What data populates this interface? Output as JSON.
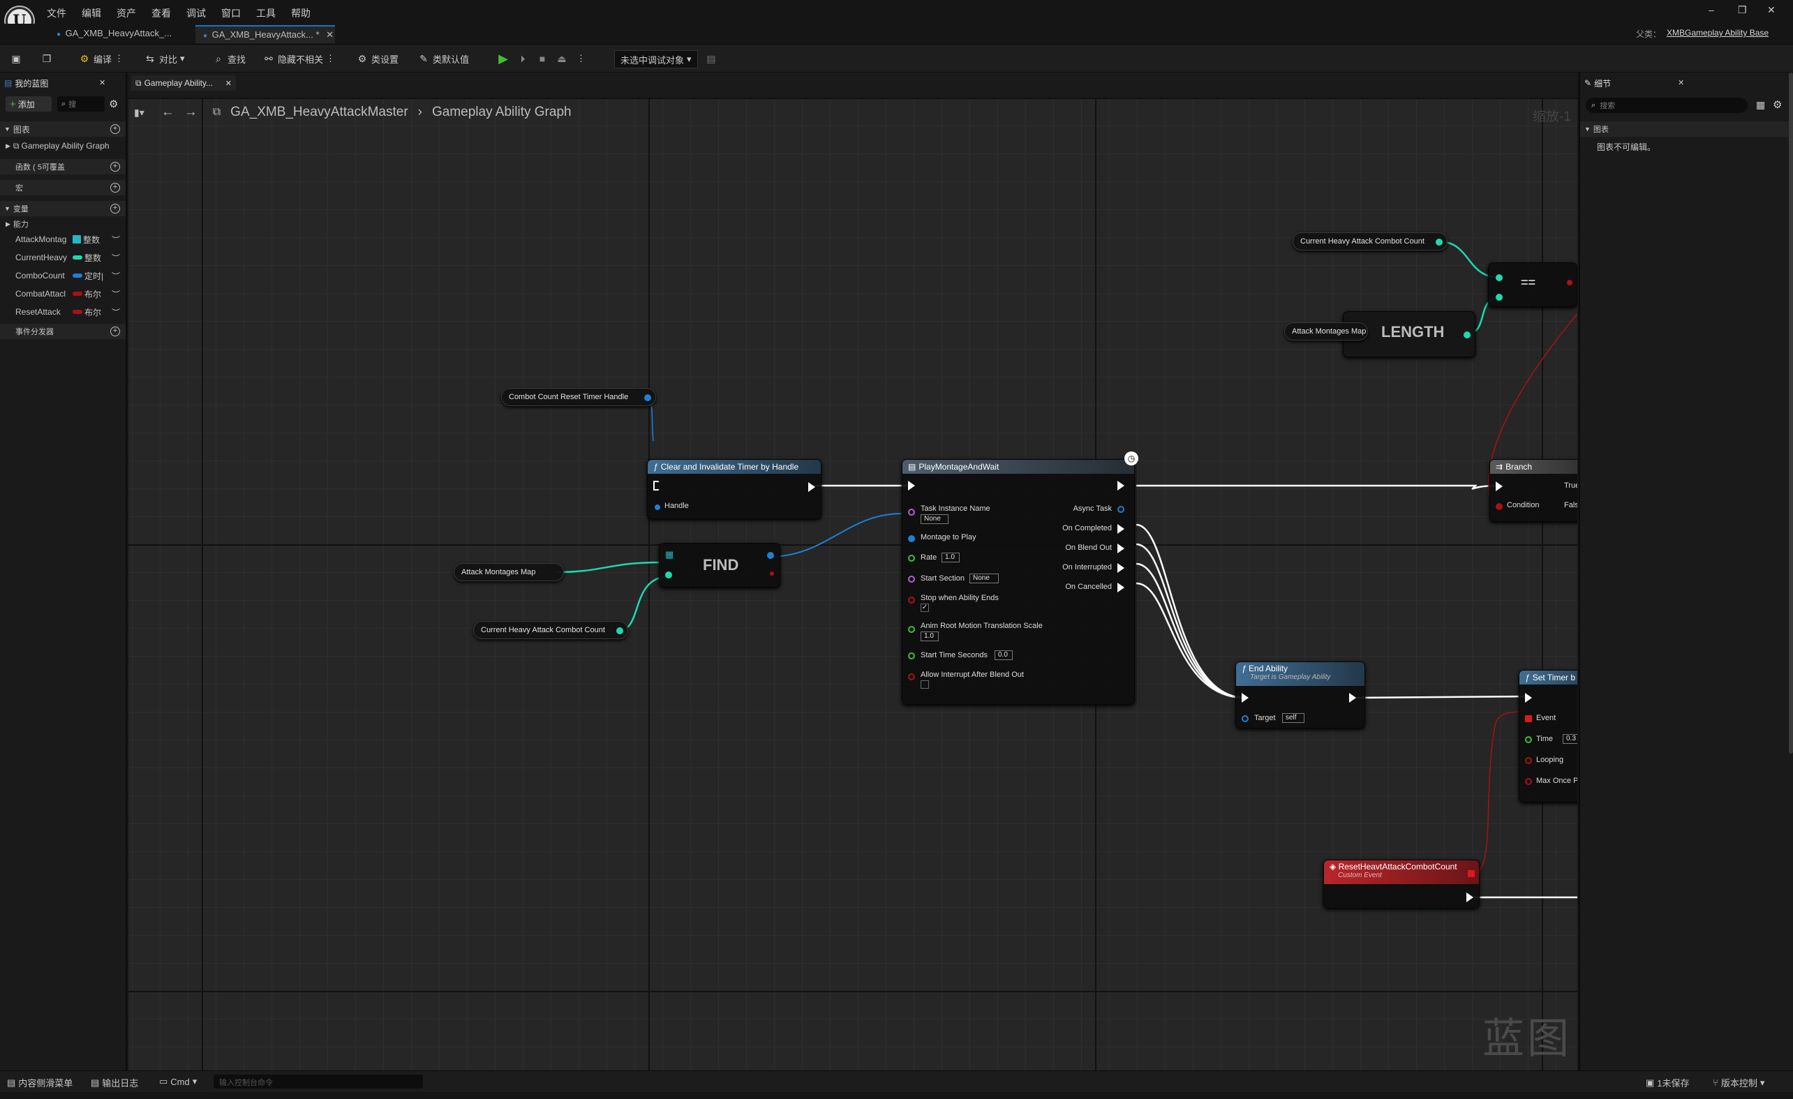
{
  "menu": [
    "文件",
    "编辑",
    "资产",
    "查看",
    "调试",
    "窗口",
    "工具",
    "帮助"
  ],
  "tabs": [
    {
      "label": "GA_XMB_HeavyAttack_..."
    },
    {
      "label": "GA_XMB_HeavyAttack... *"
    }
  ],
  "parent": {
    "label": "父类：",
    "value": "XMBGameplay Ability Base"
  },
  "window_controls": {
    "minimize": "–",
    "restore": "❐",
    "close": "✕"
  },
  "toolbar": {
    "compile": "编译",
    "diff": "对比",
    "find": "查找",
    "hide_unrelated": "隐藏不相关",
    "class_settings": "类设置",
    "class_defaults": "类默认值",
    "debug_target": "未选中调试对象"
  },
  "left_panel": {
    "title": "我的蓝图",
    "add": "添加",
    "search_placeholder": "搜",
    "graphs_header": "图表",
    "graph_item": "Gameplay Ability Graph",
    "functions_header": "函数 ( 5可覆盖",
    "macros_header": "宏",
    "variables_header": "变量",
    "category": "能力",
    "variables": [
      {
        "name": "AttackMontag",
        "type": "整数",
        "color": "#22b8c8"
      },
      {
        "name": "CurrentHeavy",
        "type": "整数",
        "color": "#1ed9b0"
      },
      {
        "name": "ComboCount",
        "type": "定时|",
        "color": "#1e7fd6"
      },
      {
        "name": "CombatAttacl",
        "type": "布尔",
        "color": "#aa1212"
      },
      {
        "name": "ResetAttack",
        "type": "布尔",
        "color": "#aa1212"
      }
    ],
    "dispatchers_header": "事件分发器"
  },
  "graph": {
    "tab": "Gameplay Ability...",
    "breadcrumb_root": "GA_XMB_HeavyAttackMaster",
    "breadcrumb_leaf": "Gameplay Ability Graph",
    "zoom": "缩放-1",
    "watermark": "蓝图",
    "nodes": {
      "combo_reset_handle": "Combot Count Reset Timer Handle",
      "current_combo_top": "Current Heavy Attack Combot Count",
      "attack_montages_top": "Attack Montages Map",
      "length": "LENGTH",
      "eq": "==",
      "branch_title": "Branch",
      "branch_true": "True",
      "branch_false": "False",
      "branch_condition": "Condition",
      "clear_timer_title": "Clear and Invalidate Timer by Handle",
      "clear_timer_handle": "Handle",
      "find": "FIND",
      "attack_montages_var": "Attack Montages Map",
      "current_combo_var": "Current Heavy Attack Combot Count",
      "pm_title": "PlayMontageAndWait",
      "pm_task_instance": "Task Instance Name",
      "pm_task_instance_val": "None",
      "pm_montage": "Montage to Play",
      "pm_rate": "Rate",
      "pm_rate_val": "1.0",
      "pm_start_section": "Start Section",
      "pm_start_section_val": "None",
      "pm_stop_when": "Stop when Ability Ends",
      "pm_anim_root": "Anim Root Motion Translation Scale",
      "pm_anim_root_val": "1.0",
      "pm_start_time": "Start Time Seconds",
      "pm_start_time_val": "0.0",
      "pm_allow_interrupt": "Allow Interrupt After Blend Out",
      "pm_async": "Async Task",
      "pm_on_completed": "On Completed",
      "pm_on_blend_out": "On Blend Out",
      "pm_on_interrupted": "On Interrupted",
      "pm_on_cancelled": "On Cancelled",
      "end_title": "End Ability",
      "end_sub": "Target is Gameplay Ability",
      "end_target": "Target",
      "end_target_val": "self",
      "set_timer_title": "Set Timer b",
      "set_timer_event": "Event",
      "set_timer_time": "Time",
      "set_timer_time_val": "0.3",
      "set_timer_looping": "Looping",
      "set_timer_max": "Max Once P",
      "reset_event_title": "ResetHeavtAttackCombotCount",
      "reset_event_sub": "Custom Event"
    }
  },
  "details": {
    "title": "细节",
    "search_placeholder": "搜索",
    "section": "图表",
    "message": "图表不可编辑。"
  },
  "statusbar": {
    "content_drawer": "内容侧滑菜单",
    "output_log": "输出日志",
    "cmd": "Cmd",
    "console_placeholder": "输入控制台命令",
    "unsaved": "1未保存",
    "source_control": "版本控制"
  }
}
